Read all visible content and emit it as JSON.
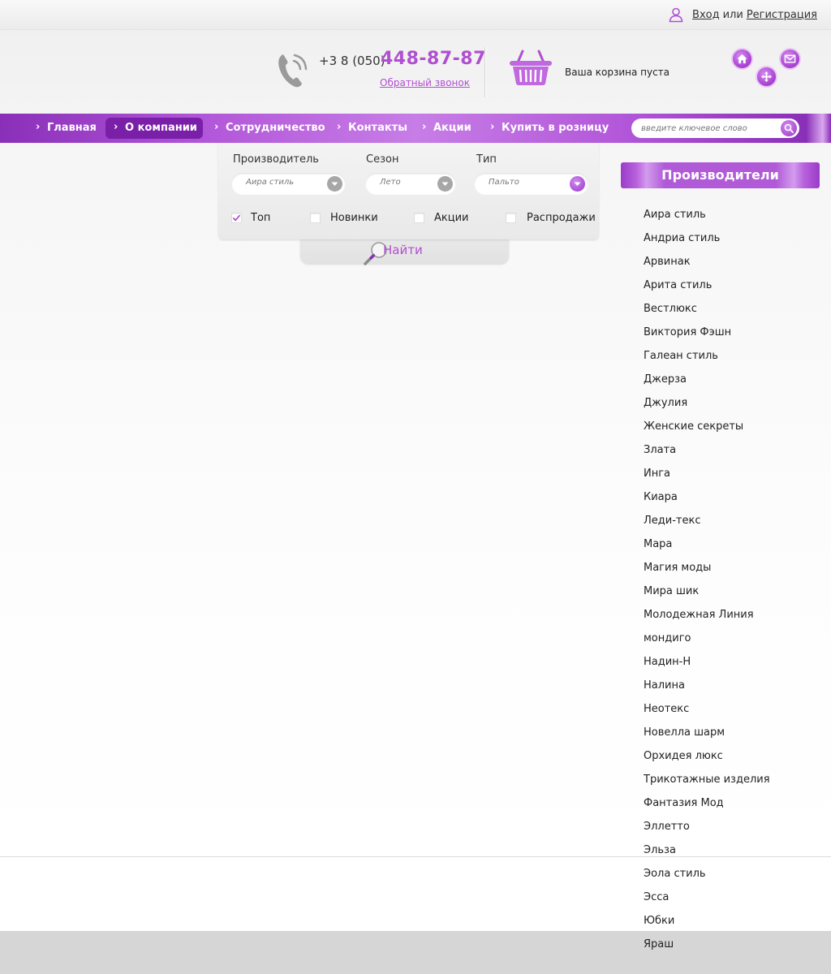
{
  "auth": {
    "login": "Вход",
    "or": "или",
    "register": "Регистрация"
  },
  "header": {
    "phone_prefix": "+3 8 (050)",
    "phone_number": "448-87-87",
    "callback": "Обратный звонок",
    "cart_text": "Ваша корзина пуста"
  },
  "nav": {
    "items": [
      "Главная",
      "О компании",
      "Сотрудничество",
      "Контакты",
      "Акции",
      "Купить в розницу"
    ],
    "active": "О компании",
    "search_placeholder": "введите ключевое слово"
  },
  "filter": {
    "manufacturer_label": "Производитель",
    "manufacturer_value": "Аира стиль",
    "season_label": "Сезон",
    "season_value": "Лето",
    "type_label": "Тип",
    "type_value": "Пальто",
    "checkboxes": [
      {
        "label": "Топ",
        "checked": true
      },
      {
        "label": "Новинки",
        "checked": false
      },
      {
        "label": "Акции",
        "checked": false
      },
      {
        "label": "Распродажи",
        "checked": false
      }
    ],
    "find": "Найти"
  },
  "sidebar": {
    "title": "Производители",
    "manufacturers": [
      "Аира стиль",
      "Андриа стиль",
      "Арвинак",
      "Арита стиль",
      "Вестлюкс",
      "Виктория Фэшн",
      "Галеан стиль",
      "Джерза",
      "Джулия",
      "Женские секреты",
      "Злата",
      "Инга",
      "Киара",
      "Леди-текс",
      "Мара",
      "Магия моды",
      "Мира шик",
      "Молодежная Линия",
      "мондиго",
      "Надин-Н",
      "Налина",
      "Неотекс",
      "Новелла шарм",
      "Орхидея люкс",
      "Трикотажные изделия",
      "Фантазия Мод",
      "Эллетто",
      "Эльза",
      "Эола стиль",
      "Эсса",
      "Юбки",
      "Яраш"
    ]
  },
  "colors": {
    "accent": "#b04fd0",
    "nav": "#b257d9",
    "nav_active": "#7a1fa8"
  }
}
